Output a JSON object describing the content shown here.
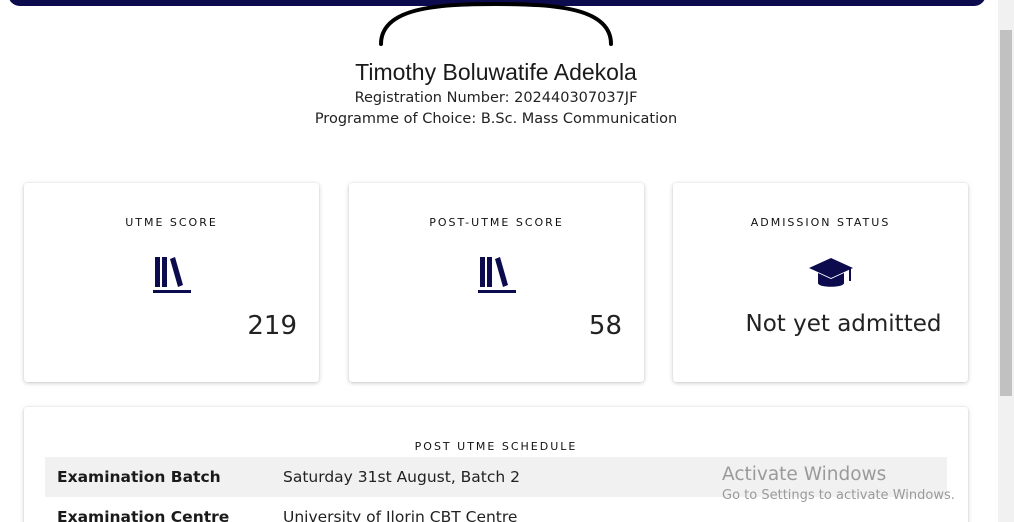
{
  "profile": {
    "name": "Timothy Boluwatife Adekola",
    "registration": "Registration Number: 202440307037JF",
    "programme": "Programme of Choice: B.Sc. Mass Communication"
  },
  "cards": {
    "utme": {
      "title": "UTME SCORE",
      "value": "219",
      "icon": "books-icon"
    },
    "post_utme": {
      "title": "POST-UTME SCORE",
      "value": "58",
      "icon": "books-icon"
    },
    "admission": {
      "title": "ADMISSION STATUS",
      "value": "Not yet admitted",
      "icon": "graduation-cap-icon"
    }
  },
  "schedule": {
    "title": "POST UTME SCHEDULE",
    "rows": [
      {
        "label": "Examination Batch",
        "value": "Saturday 31st August, Batch 2"
      },
      {
        "label": "Examination Centre",
        "value": "University of Ilorin CBT Centre"
      }
    ]
  },
  "watermark": {
    "title": "Activate Windows",
    "subtitle": "Go to Settings to activate Windows."
  },
  "colors": {
    "header_bar": "#0b0b4d",
    "icon": "#0b0b4d"
  }
}
